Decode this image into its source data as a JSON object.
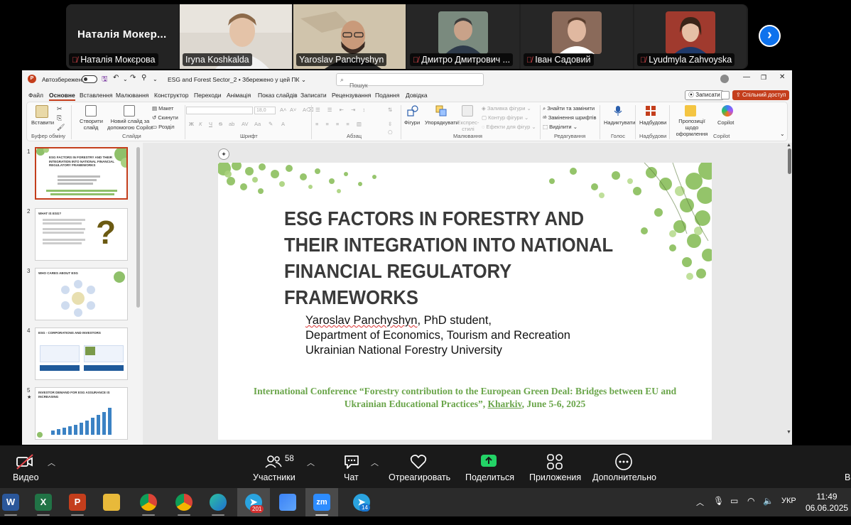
{
  "participants": {
    "namecard": "Наталія Мокер...",
    "tiles": [
      {
        "name": "Наталія Мокєрова",
        "muted": true
      },
      {
        "name": "Iryna Koshkalda",
        "muted": false
      },
      {
        "name": "Yaroslav Panchyshyn",
        "muted": false
      },
      {
        "name": "Дмитро Дмитрович ...",
        "muted": true
      },
      {
        "name": "Іван Садовий",
        "muted": true
      },
      {
        "name": "Lyudmyla Zahvoyska",
        "muted": true
      }
    ],
    "next_label": "›"
  },
  "powerpoint": {
    "autosave_label": "Автозбереження",
    "doc_title": "ESG and Forest Sector_2 • Збережено у цей ПК ⌄",
    "search_placeholder": "Пошук",
    "menu": [
      "Файл",
      "Основне",
      "Вставлення",
      "Малювання",
      "Конструктор",
      "Переходи",
      "Анімація",
      "Показ слайдів",
      "Записати",
      "Рецензування",
      "Подання",
      "Довідка"
    ],
    "active_menu": "Основне",
    "notes_button": "Записати",
    "share_button": "Спільний доступ",
    "ribbon": {
      "paste": "Вставити",
      "clipboard_group": "Буфер обміну",
      "new_slide": "Створити слайд",
      "copilot_slide": "Новий слайд за допомогою Copilot",
      "layout": "Макет",
      "reset": "Скинути",
      "section": "Розділ",
      "slides_group": "Слайди",
      "font_group": "Шрифт",
      "paragraph_group": "Абзац",
      "shapes": "Фігури",
      "arrange": "Упорядкувати",
      "quick_styles": "Експрес-стилі",
      "shape_fill": "Заливка фігури",
      "shape_outline": "Контур фігури",
      "shape_effects": "Ефекти для фігур",
      "drawing_group": "Малювання",
      "find_replace": "Знайти та замінити",
      "replace_fonts": "Замінення шрифтів",
      "select": "Виділити",
      "editing_group": "Редагування",
      "dictate": "Надиктувати",
      "voice_group": "Голос",
      "designer": "Надбудови",
      "addins_group": "Надбудови",
      "design_ideas": "Пропозиції щодо оформлення",
      "copilot": "Copilot",
      "copilot_group": "Copilot",
      "font_size": "18,0"
    },
    "thumbnails": [
      {
        "num": "1",
        "title": "ESG FACTORS IN FORESTRY AND THEIR INTEGRATION INTO NATIONAL FINANCIAL REGULATORY FRAMEWORKS"
      },
      {
        "num": "2",
        "title": "WHAT IS ESG?"
      },
      {
        "num": "3",
        "title": "WHO CARES ABOUT ESG"
      },
      {
        "num": "4",
        "title": "ESG - CORPORATIONS AND INVESTORS"
      },
      {
        "num": "5",
        "title": "INVESTOR DEMAND FOR ESG ASSURANCE IS INCREASING"
      }
    ],
    "slide": {
      "title": "ESG FACTORS IN FORESTRY AND THEIR INTEGRATION INTO NATIONAL FINANCIAL REGULATORY FRAMEWORKS",
      "author_name": "Yaroslav Panchyshyn",
      "author_role": ", PhD student,",
      "department": "Department of Economics, Tourism and Recreation",
      "university": "Ukrainian National Forestry University",
      "conference_pre": "International Conference “Forestry contribution to the European Green Deal: Bridges between EU and Ukrainian Educational Practices”, ",
      "conference_city": "Kharkiv",
      "conference_date": ", June 5-6, 2025"
    }
  },
  "zoom_toolbar": {
    "video": "Видео",
    "participants": "Участники",
    "participants_count": "58",
    "chat": "Чат",
    "react": "Отреагировать",
    "share": "Поделиться",
    "apps": "Приложения",
    "more": "Дополнительно",
    "cut_label": "В"
  },
  "taskbar": {
    "apps": [
      "word",
      "excel",
      "powerpoint",
      "explorer",
      "chrome",
      "chrome-profile",
      "edge",
      "telegram",
      "photos",
      "zoom",
      "telegram-2"
    ],
    "telegram_badge": "201",
    "telegram2_badge": "14",
    "language": "УКР",
    "time": "11:49",
    "date": "06.06.2025"
  },
  "colors": {
    "accent_pp": "#c43e1c",
    "zoom_blue": "#0e72ed",
    "speaking": "#23d366",
    "conference_green": "#6aa54a"
  }
}
